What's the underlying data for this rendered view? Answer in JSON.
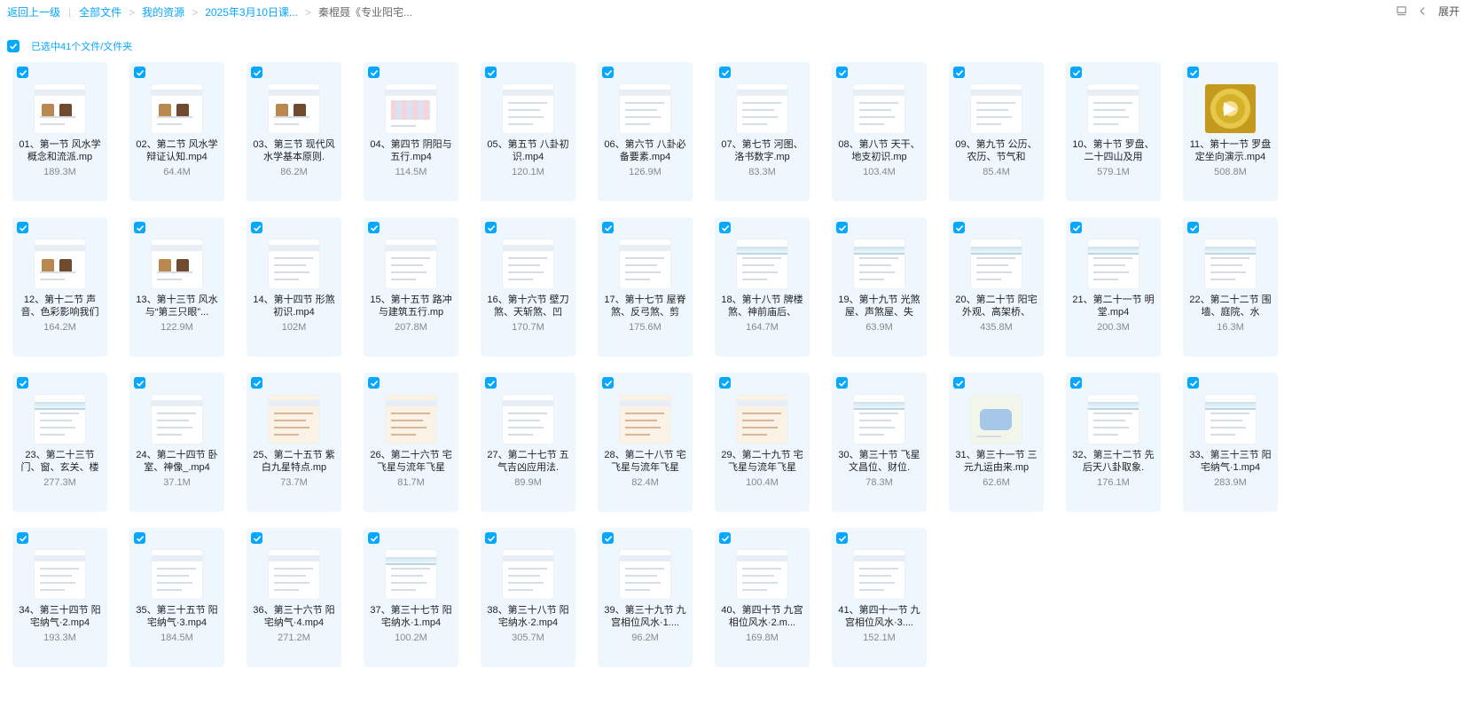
{
  "breadcrumb": {
    "back": "返回上一级",
    "items": [
      "全部文件",
      "我的资源",
      "2025年3月10日课...",
      "秦棍聂《专业阳宅..."
    ]
  },
  "topRight": {
    "expand": "展开"
  },
  "selection": {
    "text": "已选中41个文件/文件夹"
  },
  "colors": {
    "accent": "#06a7ff",
    "cardBg": "#eef7fe"
  },
  "files": [
    {
      "name": "01、第一节 风水学概念和流派.mp",
      "size": "189.3M",
      "thumb": "photo"
    },
    {
      "name": "02、第二节 风水学辩证认知.mp4",
      "size": "64.4M",
      "thumb": "photo"
    },
    {
      "name": "03、第三节 现代风水学基本原则.",
      "size": "86.2M",
      "thumb": "photo"
    },
    {
      "name": "04、第四节 阴阳与五行.mp4",
      "size": "114.5M",
      "thumb": "table"
    },
    {
      "name": "05、第五节 八卦初识.mp4",
      "size": "120.1M",
      "thumb": "doc"
    },
    {
      "name": "06、第六节 八卦必备要素.mp4",
      "size": "126.9M",
      "thumb": "doc"
    },
    {
      "name": "07、第七节 河图、洛书数字.mp",
      "size": "83.3M",
      "thumb": "doc"
    },
    {
      "name": "08、第八节 天干、地支初识.mp",
      "size": "103.4M",
      "thumb": "doc"
    },
    {
      "name": "09、第九节 公历、农历、节气和",
      "size": "85.4M",
      "thumb": "doc"
    },
    {
      "name": "10、第十节 罗盘、二十四山及用",
      "size": "579.1M",
      "thumb": "doc"
    },
    {
      "name": "11、第十一节 罗盘定坐向演示.mp4",
      "size": "508.8M",
      "thumb": "compass"
    },
    {
      "name": "12、第十二节 声音、色彩影响我们",
      "size": "164.2M",
      "thumb": "photo"
    },
    {
      "name": "13、第十三节 风水与“第三只眼”...",
      "size": "122.9M",
      "thumb": "photo"
    },
    {
      "name": "14、第十四节 形煞初识.mp4",
      "size": "102M",
      "thumb": "doc"
    },
    {
      "name": "15、第十五节 路冲与建筑五行.mp",
      "size": "207.8M",
      "thumb": "doc"
    },
    {
      "name": "16、第十六节 壁刀煞、天斩煞、凹",
      "size": "170.7M",
      "thumb": "doc"
    },
    {
      "name": "17、第十七节 屋脊煞、反弓煞、剪",
      "size": "175.6M",
      "thumb": "doc"
    },
    {
      "name": "18、第十八节 牌楼煞、神前庙后、",
      "size": "164.7M",
      "thumb": "wave"
    },
    {
      "name": "19、第十九节 光煞屋、声煞屋、失",
      "size": "63.9M",
      "thumb": "wave"
    },
    {
      "name": "20、第二十节 阳宅外观、高架桥、",
      "size": "435.8M",
      "thumb": "wave"
    },
    {
      "name": "21、第二十一节 明堂.mp4",
      "size": "200.3M",
      "thumb": "wave"
    },
    {
      "name": "22、第二十二节 围墙、庭院、水",
      "size": "16.3M",
      "thumb": "wave"
    },
    {
      "name": "23、第二十三节 门、窗、玄关、楼",
      "size": "277.3M",
      "thumb": "wave"
    },
    {
      "name": "24、第二十四节 卧室、神像_.mp4",
      "size": "37.1M",
      "thumb": "doc"
    },
    {
      "name": "25、第二十五节 紫白九星特点.mp",
      "size": "73.7M",
      "thumb": "paper"
    },
    {
      "name": "26、第二十六节 宅飞星与流年飞星",
      "size": "81.7M",
      "thumb": "paper"
    },
    {
      "name": "27、第二十七节 五气吉凶应用法.",
      "size": "89.9M",
      "thumb": "doc"
    },
    {
      "name": "28、第二十八节 宅飞星与流年飞星",
      "size": "82.4M",
      "thumb": "paper"
    },
    {
      "name": "29、第二十九节 宅飞星与流年飞星",
      "size": "100.4M",
      "thumb": "paper"
    },
    {
      "name": "30、第三十节 飞星文昌位、财位.",
      "size": "78.3M",
      "thumb": "wave"
    },
    {
      "name": "31、第三十一节 三元九运由来.mp",
      "size": "62.6M",
      "thumb": "map"
    },
    {
      "name": "32、第三十二节 先后天八卦取象.",
      "size": "176.1M",
      "thumb": "wave"
    },
    {
      "name": "33、第三十三节 阳宅纳气·1.mp4",
      "size": "283.9M",
      "thumb": "wave"
    },
    {
      "name": "34、第三十四节 阳宅纳气·2.mp4",
      "size": "193.3M",
      "thumb": "doc"
    },
    {
      "name": "35、第三十五节 阳宅纳气·3.mp4",
      "size": "184.5M",
      "thumb": "doc"
    },
    {
      "name": "36、第三十六节 阳宅纳气·4.mp4",
      "size": "271.2M",
      "thumb": "doc"
    },
    {
      "name": "37、第三十七节 阳宅纳水·1.mp4",
      "size": "100.2M",
      "thumb": "wave"
    },
    {
      "name": "38、第三十八节 阳宅纳水·2.mp4",
      "size": "305.7M",
      "thumb": "doc"
    },
    {
      "name": "39、第三十九节 九宫相位风水·1....",
      "size": "96.2M",
      "thumb": "doc"
    },
    {
      "name": "40、第四十节 九宫相位风水·2.m...",
      "size": "169.8M",
      "thumb": "doc"
    },
    {
      "name": "41、第四十一节 九宫相位风水·3....",
      "size": "152.1M",
      "thumb": "doc"
    }
  ]
}
